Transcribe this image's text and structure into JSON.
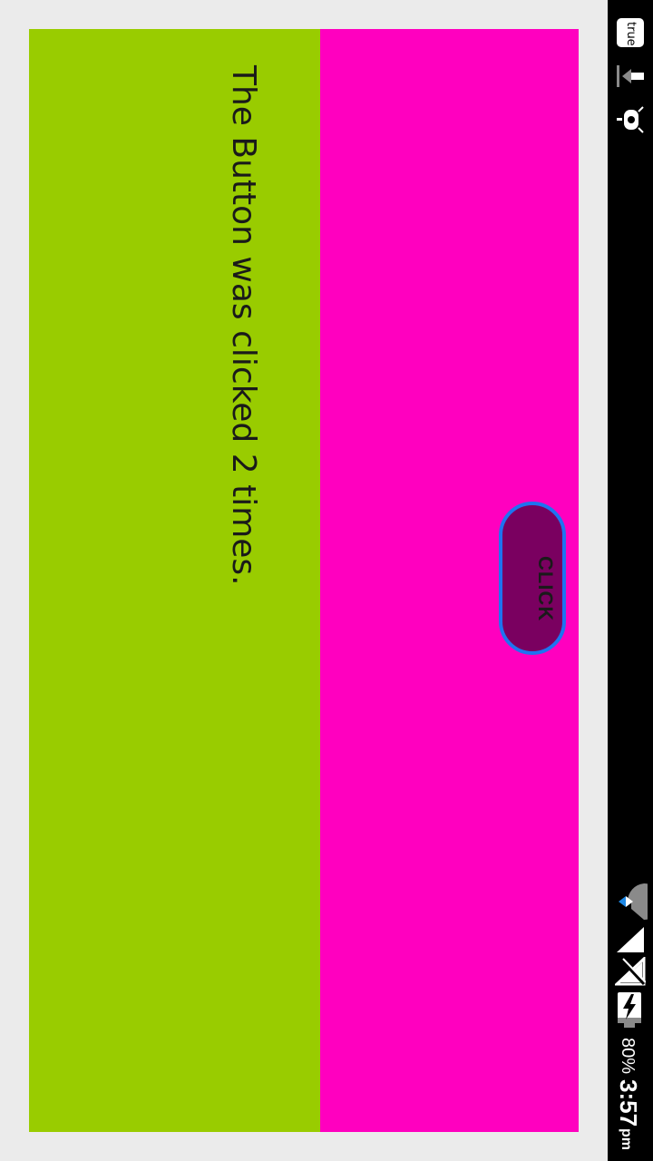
{
  "colors": {
    "left_panel": "#99cc00",
    "right_panel": "#ff00bf",
    "button_fill": "#7a0060",
    "button_border": "#1e74f0",
    "status_bar": "#000000"
  },
  "main": {
    "message": "The Button was clicked 2 times.",
    "button_label": "CLICK"
  },
  "status_bar": {
    "badge_text": "true",
    "battery_percent": "80%",
    "time": "3:57",
    "am_pm": "pm",
    "icons": [
      "usb-debug-icon",
      "bug-icon",
      "data-saver-icon",
      "signal-icon",
      "no-sim-icon",
      "battery-charging-icon"
    ]
  }
}
